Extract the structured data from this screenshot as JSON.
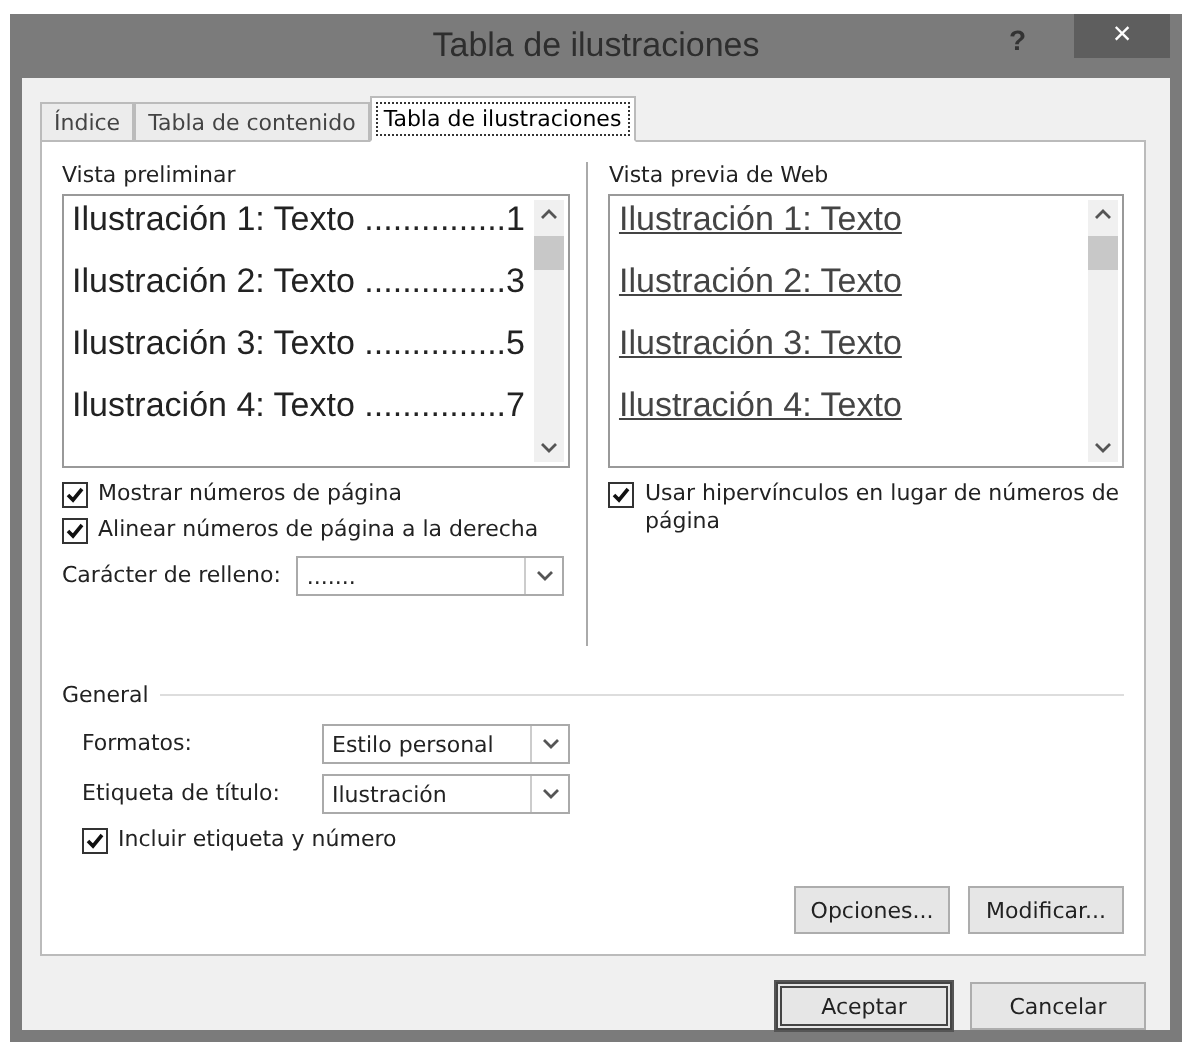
{
  "window": {
    "title": "Tabla de ilustraciones",
    "help": "?",
    "close": "×"
  },
  "tabs": [
    {
      "label": "Índice",
      "selected": false
    },
    {
      "label": "Tabla de contenido",
      "selected": false
    },
    {
      "label": "Tabla de ilustraciones",
      "selected": true
    }
  ],
  "print_preview": {
    "label": "Vista preliminar",
    "items": [
      {
        "text": "Ilustración 1: Texto",
        "leader": "...............",
        "page": "1"
      },
      {
        "text": "Ilustración 2: Texto",
        "leader": "...............",
        "page": "3"
      },
      {
        "text": "Ilustración 3: Texto",
        "leader": "...............",
        "page": "5"
      },
      {
        "text": "Ilustración 4: Texto",
        "leader": "...............",
        "page": "7"
      }
    ]
  },
  "web_preview": {
    "label": "Vista previa de Web",
    "items": [
      "Ilustración 1: Texto",
      "Ilustración 2: Texto",
      "Ilustración 3: Texto",
      "Ilustración 4: Texto"
    ]
  },
  "left_options": [
    {
      "label": "Mostrar números de página",
      "checked": true
    },
    {
      "label": "Alinear números de página a la derecha",
      "checked": true
    }
  ],
  "fill_char": {
    "label": "Carácter de relleno:",
    "value": "......."
  },
  "right_options": [
    {
      "label": "Usar hipervínculos en lugar de números de página",
      "checked": true
    }
  ],
  "general": {
    "title": "General",
    "formats": {
      "label": "Formatos:",
      "value": "Estilo personal"
    },
    "caption": {
      "label": "Etiqueta de título:",
      "value": "Ilustración"
    },
    "include": {
      "label": "Incluir etiqueta y número",
      "checked": true
    }
  },
  "panel_buttons": [
    "Opciones...",
    "Modificar..."
  ],
  "buttons": [
    {
      "label": "Aceptar",
      "default": true
    },
    {
      "label": "Cancelar",
      "default": false
    }
  ]
}
